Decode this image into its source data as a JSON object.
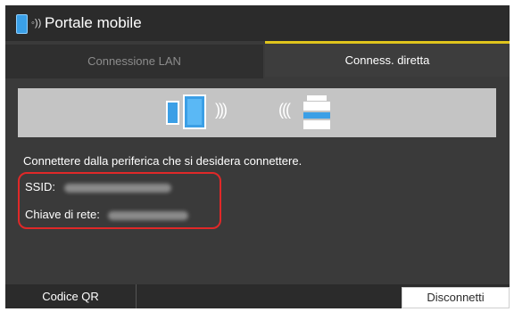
{
  "header": {
    "title": "Portale mobile",
    "app_icon": "mobile-portal-icon"
  },
  "tabs": [
    {
      "label": "Connessione LAN",
      "active": false
    },
    {
      "label": "Conness. diretta",
      "active": true
    }
  ],
  "colors": {
    "accent_tab": "#e0c41c",
    "highlight": "#e02828",
    "device_blue": "#3b9fe6"
  },
  "content": {
    "instruction": "Connettere dalla periferica che si desidera connettere.",
    "ssid_label": "SSID:",
    "key_label": "Chiave di rete:"
  },
  "footer": {
    "qr_button": "Codice QR",
    "disconnect_button": "Disconnetti"
  }
}
